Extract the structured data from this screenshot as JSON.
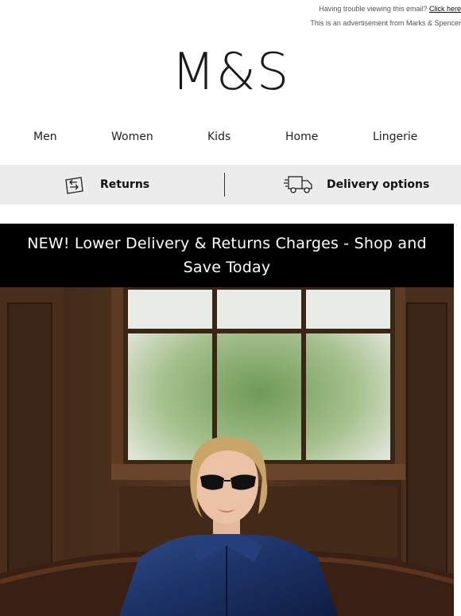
{
  "preheader": {
    "trouble_text": "Having trouble viewing this email?",
    "click_here": "Click here",
    "ad_notice": "This is an advertisement from Marks & Spencer"
  },
  "brand": {
    "logo_text": "M&S"
  },
  "nav": {
    "items": [
      {
        "label": "Men"
      },
      {
        "label": "Women"
      },
      {
        "label": "Kids"
      },
      {
        "label": "Home"
      },
      {
        "label": "Lingerie"
      }
    ]
  },
  "services": {
    "returns_label": "Returns",
    "delivery_label": "Delivery options",
    "returns_icon": "returns-box-icon",
    "delivery_icon": "delivery-truck-icon"
  },
  "promo": {
    "text": "NEW! Lower Delivery & Returns Charges - Shop and Save Today"
  },
  "colors": {
    "service_bar_bg": "#ececec",
    "promo_bg": "#000000",
    "promo_text": "#ffffff"
  }
}
